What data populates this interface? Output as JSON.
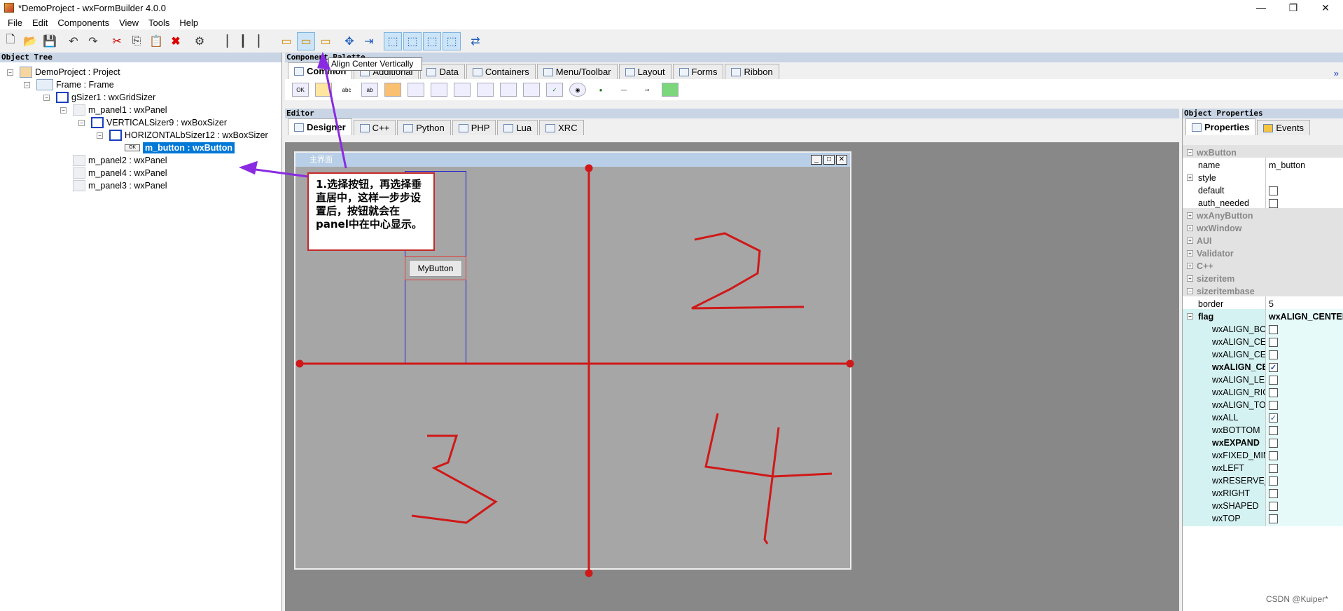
{
  "window": {
    "title": "*DemoProject - wxFormBuilder 4.0.0",
    "minimize": "—",
    "maximize": "❐",
    "close": "✕"
  },
  "menu": [
    "File",
    "Edit",
    "Components",
    "View",
    "Tools",
    "Help"
  ],
  "object_tree": {
    "header": "Object Tree",
    "nodes": [
      {
        "label": "DemoProject : Project"
      },
      {
        "label": "Frame : Frame"
      },
      {
        "label": "gSizer1 : wxGridSizer"
      },
      {
        "label": "m_panel1 : wxPanel"
      },
      {
        "label": "VERTICALSizer9 : wxBoxSizer"
      },
      {
        "label": "HORIZONTALbSizer12 : wxBoxSizer"
      },
      {
        "label": "m_button : wxButton"
      },
      {
        "label": "m_panel2 : wxPanel"
      },
      {
        "label": "m_panel4 : wxPanel"
      },
      {
        "label": "m_panel3 : wxPanel"
      }
    ]
  },
  "palette": {
    "header": "Component Palette",
    "tooltip": "Align Center Vertically",
    "tabs": [
      "Common",
      "Additional",
      "Data",
      "Containers",
      "Menu/Toolbar",
      "Layout",
      "Forms",
      "Ribbon"
    ],
    "more": "»"
  },
  "editor": {
    "header": "Editor",
    "tabs": [
      "Designer",
      "C++",
      "Python",
      "PHP",
      "Lua",
      "XRC"
    ],
    "frame_title": "主界面",
    "button_label": "MyButton",
    "frame_buttons": {
      "min": "_",
      "max": "□",
      "close": "✕"
    }
  },
  "annotation": {
    "text": "1.选择按钮，再选择垂直居中，这样一步步设置后，按钮就会在panel中在中心显示。",
    "color": "#c62828",
    "arrow_color": "#8a2be2",
    "hand_digits": [
      "2",
      "3",
      "4"
    ]
  },
  "properties": {
    "header": "Object Properties",
    "tabs": [
      "Properties",
      "Events"
    ],
    "rows": [
      {
        "key": "wxButton",
        "type": "cat"
      },
      {
        "key": "name",
        "value": "m_button"
      },
      {
        "key": "style",
        "value": ""
      },
      {
        "key": "default",
        "check": false
      },
      {
        "key": "auth_needed",
        "check": false
      },
      {
        "key": "wxAnyButton",
        "type": "cat"
      },
      {
        "key": "wxWindow",
        "type": "cat"
      },
      {
        "key": "AUI",
        "type": "cat"
      },
      {
        "key": "Validator",
        "type": "cat"
      },
      {
        "key": "C++",
        "type": "cat"
      },
      {
        "key": "sizeritem",
        "type": "cat"
      },
      {
        "key": "sizeritembase",
        "type": "cat"
      },
      {
        "key": "border",
        "value": "5"
      },
      {
        "key": "flag",
        "value": "wxALIGN_CENTER",
        "bold": true
      },
      {
        "key": "wxALIGN_BO",
        "check": false
      },
      {
        "key": "wxALIGN_CE",
        "check": false
      },
      {
        "key": "wxALIGN_CE",
        "check": false
      },
      {
        "key": "wxALIGN_CE",
        "check": true,
        "bold": true
      },
      {
        "key": "wxALIGN_LEF",
        "check": false
      },
      {
        "key": "wxALIGN_RIG",
        "check": false
      },
      {
        "key": "wxALIGN_TO",
        "check": false
      },
      {
        "key": "wxALL",
        "check": true
      },
      {
        "key": "wxBOTTOM",
        "check": false
      },
      {
        "key": "wxEXPAND",
        "check": false,
        "bold": true
      },
      {
        "key": "wxFIXED_MIN",
        "check": false
      },
      {
        "key": "wxLEFT",
        "check": false
      },
      {
        "key": "wxRESERVE_S",
        "check": false
      },
      {
        "key": "wxRIGHT",
        "check": false
      },
      {
        "key": "wxSHAPED",
        "check": false
      },
      {
        "key": "wxTOP",
        "check": false
      }
    ]
  },
  "watermark": "CSDN @Kuiper*"
}
